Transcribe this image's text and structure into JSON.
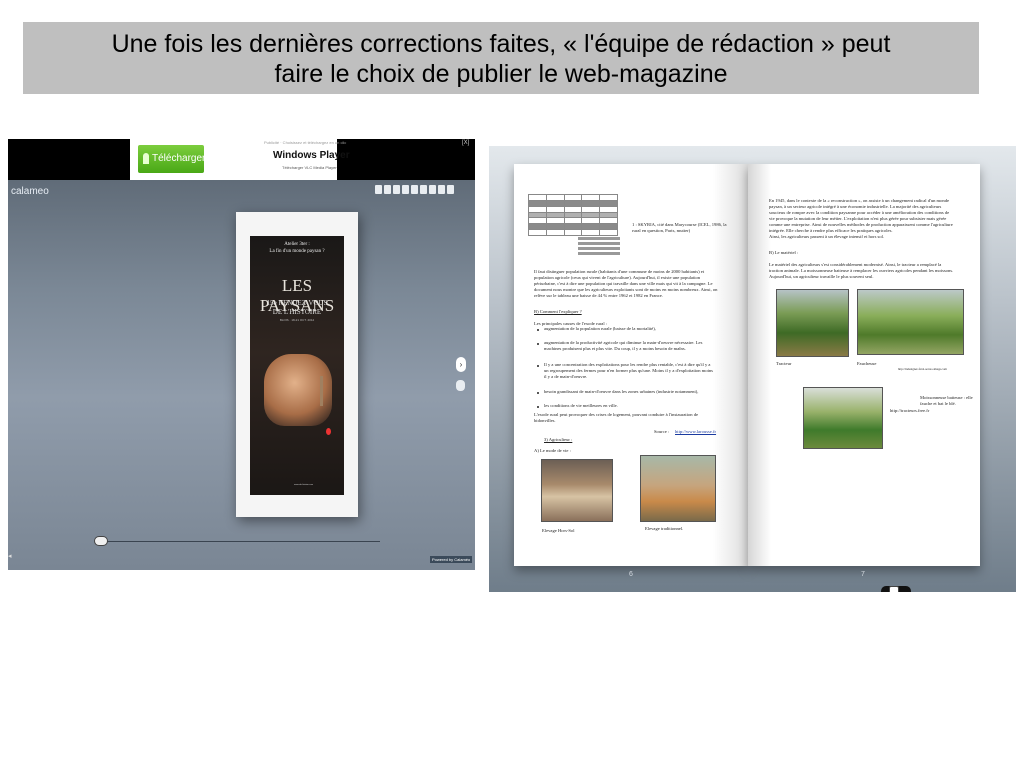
{
  "slide": {
    "title_line1": "Une fois les dernières corrections faites, « l'équipe de rédaction » peut",
    "title_line2": "faire le choix de publier le web-magazine"
  },
  "viewer": {
    "logo": "calameo",
    "ad": {
      "download_label": "Télécharger",
      "product_title": "Windows Player",
      "product_subtitle": "Télécharger VLC Media Player",
      "top_caption": "Publicité · Choisissez et téléchargez en un clic",
      "close": "[X]"
    },
    "book_cover": {
      "line1": "Atelier 3ter :",
      "line2": "La fin d'un monde paysan ?",
      "title": "LES PAYSANS",
      "sub1": "15e RENDEZ-VOUS",
      "sub2": "DE L'HISTOIRE",
      "sub3": "BLOIS · 18-21 OCT. 2012",
      "footer": "www.rdv-histoire.com"
    },
    "next_glyph": "›",
    "left_arrow": "◂",
    "powered_by": "Powered by Calaméo"
  },
  "spread": {
    "left": {
      "source_note": "1 : SKYRIA, cité dans Marycourse (ICEL, 1986, la rural en question, Paris, mutter)",
      "para1_l1": "Il faut distinguer population rurale (habitants d'une commune de moins de 2000 habitants) et",
      "para1_l2": "population agricole (ceux qui vivent de l'agriculture). Aujourd'hui, il existe une population",
      "para1_l3": "périurbaine, c'est à dire une population qui travaille dans une ville mais qui vit à la campagne. Le",
      "para1_l4": "document nous montre que les agriculteurs exploitants sont de moins en moins nombreux. Ainsi, on",
      "para1_l5": "relève sur le tableau une baisse de 44 % entre 1962 et 1982 en France.",
      "heading_b": "B) Comment l'expliquer ?",
      "intro": "Les principales causes de l'exode rural :",
      "b1": "augmentation de la population rurale (baisse de la mortalité),",
      "b2_l1": "augmentation de la productivité agricole qui diminue la main-d'oeuvre nécessaire. Les",
      "b2_l2": "machines produisent plus et plus vite. Du coup, il y a moins besoin de maîns.",
      "b3_l1": "Il y a une concentration des exploitations pour les rendre plus rentable, c'est à dire qu'il y a",
      "b3_l2": "un regroupement des fermes pour n'en former plus qu'une. Moins il y a d'exploitation moins",
      "b3_l3": "il y a de main-d'oeuvre.",
      "b4": "besoin grandissant de main-d'oeuvre dans les zones urbaines (industrie notamment),",
      "b5": "les conditions de vie meilleures en ville.",
      "concl_l1": "L'exode rural peut provoquer des crises de logement, pouvant conduire à l'instauration de",
      "concl_l2": "bidonvilles.",
      "source": "Source :",
      "source_link": "http://www.larousse.fr",
      "heading_3": "3)   Agriculteur :",
      "heading_a": "A) Le mode de vie :",
      "cap1": "Elevage Hors-Sol",
      "cap2": "Elevage traditionnel."
    },
    "right": {
      "p1_l1": "En 1945, dans le contexte de la « reconstruction », on assiste à un changement radical d'un monde",
      "p1_l2": "paysan, à un secteur agricole intégré à une économie industrielle. La majorité des agriculteurs",
      "p1_l3": "soucieux de rompre avec la condition paysanne pour accéder à une amélioration des conditions de",
      "p1_l4": "vie provoque la mutation de leur métier. L'exploitation n'est plus gérée pour subsister mais gérée",
      "p1_l5": "comme une entreprise. Ainsi de nouvelles méthodes de production apparaissent comme l'agriculture",
      "p1_l6": "intégrée. Elle cherche à rendre plus efficace les pratiques agricoles.",
      "p1_l7": "Ainsi, les agriculteurs passent à un élevage intensif et hors sol.",
      "heading_b": "B) Le matériel :",
      "p2_l1": "Le matériel des agriculteurs s'est considérablement modernisé. Ainsi, le tracteur a remplacé la",
      "p2_l2": "traction animale. La moissonneuse batteuse à remplacer les ouvriers agricoles pendant les moissons.",
      "p2_l3": "Aujourd'hui, un agriculteur travaille le plus souvent seul.",
      "cap_tractor": "Tracteur",
      "cap_faucheuse": "Faucheuse",
      "url1": "http://indesigner-farol-serrao-image.com",
      "cap_mois_l1": "Moissonneuse batteuse : elle",
      "cap_mois_l2": "fauche et bat le blé.",
      "url2": "http://tracteurs.free.fr"
    },
    "page_left_num": "6",
    "page_right_num": "7"
  }
}
